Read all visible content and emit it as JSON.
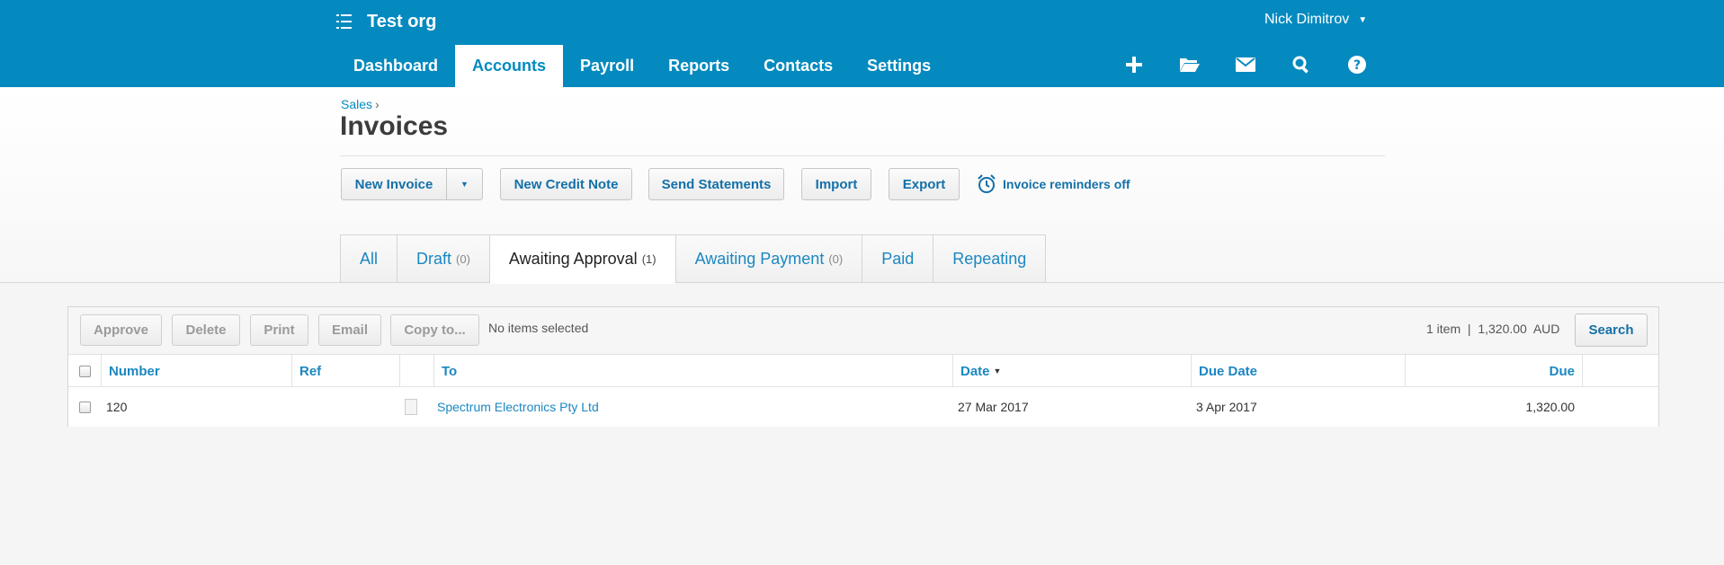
{
  "header": {
    "org_name": "Test org",
    "user_name": "Nick Dimitrov",
    "nav": [
      "Dashboard",
      "Accounts",
      "Payroll",
      "Reports",
      "Contacts",
      "Settings"
    ],
    "active_nav": "Accounts",
    "icons": [
      "plus-icon",
      "folder-icon",
      "mail-icon",
      "search-icon",
      "help-icon"
    ],
    "brand_color": "#048abf"
  },
  "page": {
    "breadcrumb": "Sales",
    "breadcrumb_sep": "›",
    "title": "Invoices"
  },
  "actions": {
    "new_invoice": "New Invoice",
    "new_credit_note": "New Credit Note",
    "send_statements": "Send Statements",
    "import": "Import",
    "export": "Export",
    "reminders": "Invoice reminders off"
  },
  "tabs": [
    {
      "label": "All",
      "count": ""
    },
    {
      "label": "Draft",
      "count": "(0)"
    },
    {
      "label": "Awaiting Approval",
      "count": "(1)"
    },
    {
      "label": "Awaiting Payment",
      "count": "(0)"
    },
    {
      "label": "Paid",
      "count": ""
    },
    {
      "label": "Repeating",
      "count": ""
    }
  ],
  "active_tab": "Awaiting Approval",
  "toolbar": {
    "approve": "Approve",
    "delete": "Delete",
    "print": "Print",
    "email": "Email",
    "copy_to": "Copy to...",
    "selection_status": "No items selected",
    "summary": "1 item  |  1,320.00  AUD",
    "search": "Search"
  },
  "table": {
    "columns": [
      "Number",
      "Ref",
      "To",
      "Date",
      "Due Date",
      "Due"
    ],
    "sort_column": "Date",
    "rows": [
      {
        "number": "120",
        "ref": "",
        "to": "Spectrum Electronics Pty Ltd",
        "date": "27 Mar 2017",
        "due_date": "3 Apr 2017",
        "due": "1,320.00"
      }
    ]
  }
}
